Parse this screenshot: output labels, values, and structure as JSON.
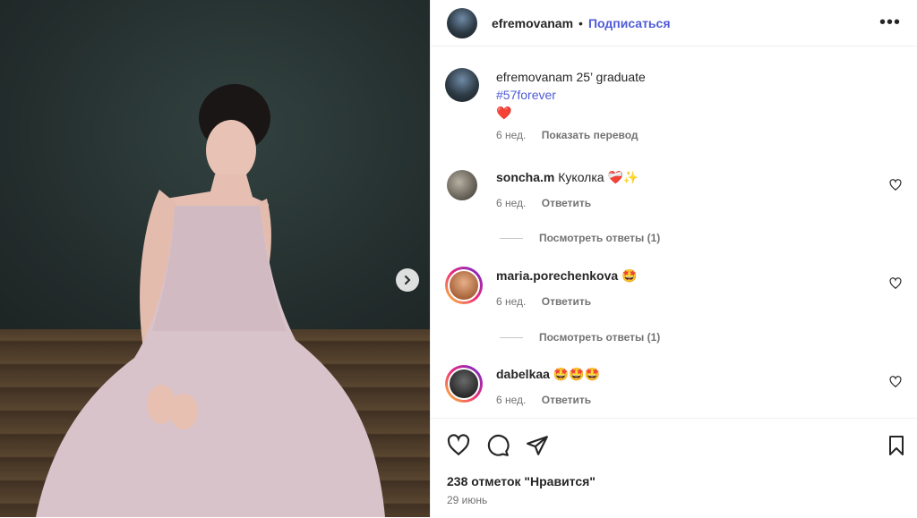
{
  "post": {
    "author": "efremovanam",
    "follow_label": "Подписаться",
    "dot": "•",
    "more": "•••"
  },
  "caption": {
    "username": "efremovanam",
    "text": "25’ graduate",
    "hashtag": "#57forever",
    "emoji": "❤️",
    "time": "6 нед.",
    "translate_label": "Показать перевод"
  },
  "comments": [
    {
      "username": "soncha.m",
      "text": "Куколка ❤️‍🩹✨",
      "time": "6 нед.",
      "reply_label": "Ответить",
      "view_replies": "Посмотреть ответы (1)"
    },
    {
      "username": "maria.porechenkova",
      "text": "🤩",
      "time": "6 нед.",
      "reply_label": "Ответить",
      "view_replies": "Посмотреть ответы (1)"
    },
    {
      "username": "dabelkaa",
      "text": "🤩🤩🤩",
      "time": "6 нед.",
      "reply_label": "Ответить"
    }
  ],
  "footer": {
    "likes": "238 отметок \"Нравится\"",
    "date": "29 июнь"
  },
  "icons": {
    "like": "heart-icon",
    "comment": "comment-icon",
    "share": "share-icon",
    "save": "bookmark-icon",
    "next": "chevron-right-icon"
  },
  "colors": {
    "link": "#4f5bd5",
    "secondary": "#737373"
  }
}
